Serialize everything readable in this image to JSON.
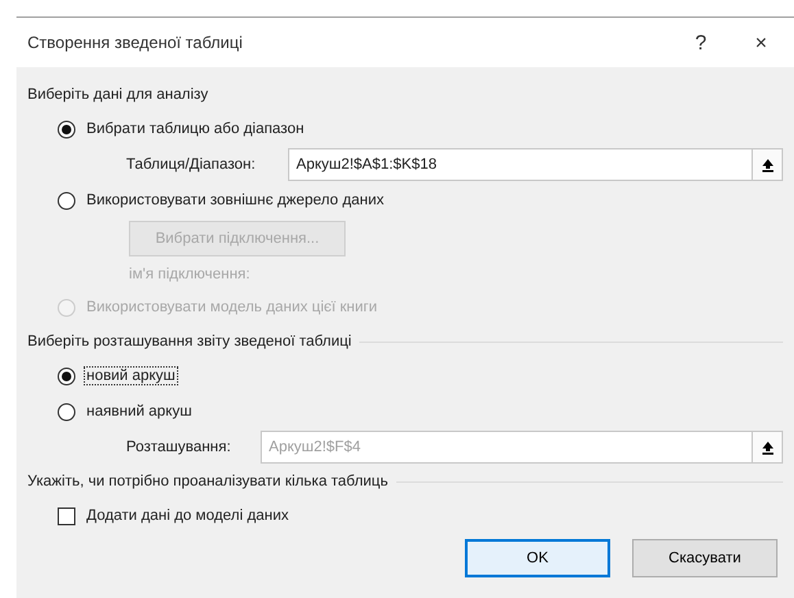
{
  "window": {
    "title": "Створення зведеної таблиці",
    "help": "?",
    "close": "×"
  },
  "source": {
    "heading": "Виберіть дані для аналізу",
    "options": [
      {
        "kind": "range",
        "label": "Вибрати таблицю або діапазон",
        "selected": true,
        "disabled": false,
        "field_label": "Таблиця/Діапазон:",
        "value": "Аркуш2!$A$1:$K$18",
        "field_disabled": false
      },
      {
        "kind": "connection",
        "label": "Використовувати зовнішнє джерело даних",
        "selected": false,
        "disabled": false,
        "button": "Вибрати підключення...",
        "button_disabled": true,
        "note": "ім'я підключення:"
      },
      {
        "kind": "plain",
        "label": "Використовувати модель даних цієї книги",
        "selected": false,
        "disabled": true
      }
    ]
  },
  "placement": {
    "heading": "Виберіть розташування звіту зведеної таблиці",
    "options": [
      {
        "kind": "plain",
        "label": "новий аркуш",
        "selected": true,
        "disabled": false,
        "focused": true
      },
      {
        "kind": "range",
        "label": "наявний аркуш",
        "selected": false,
        "disabled": false,
        "focused": false,
        "field_label": "Розташування:",
        "value": "Аркуш2!$F$4",
        "field_disabled": true
      }
    ]
  },
  "multiple": {
    "heading": "Укажіть, чи потрібно проаналізувати кілька таблиць",
    "checkbox": {
      "label": "Додати дані до моделі даних",
      "checked": false
    }
  },
  "buttons": [
    {
      "label": "OK",
      "default": true
    },
    {
      "label": "Скасувати",
      "default": false
    }
  ]
}
